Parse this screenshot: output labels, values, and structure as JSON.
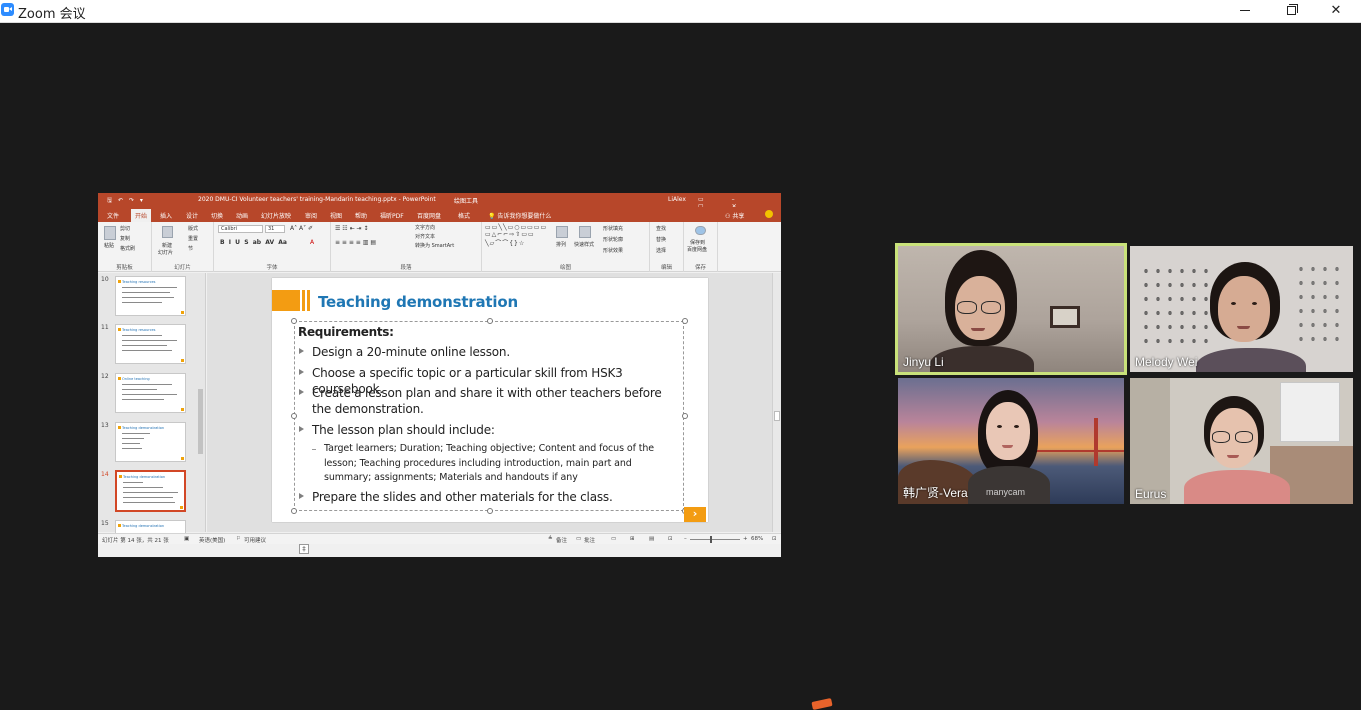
{
  "window": {
    "title": "Zoom 会议",
    "minimize_icon": "minimize-icon",
    "maximize_icon": "restore-icon",
    "close_glyph": "✕"
  },
  "powerpoint": {
    "quick_access": "🖫 ↶ ↷ ▾",
    "document_title": "2020 DMU-CI Volunteer teachers' training-Mandarin teaching.pptx - PowerPoint",
    "context_tools": "绘图工具",
    "user": "LiAlex",
    "window_buttons": "▭ – ▢ ✕",
    "tabs": [
      "文件",
      "开始",
      "插入",
      "设计",
      "切换",
      "动画",
      "幻灯片放映",
      "审阅",
      "视图",
      "帮助",
      "福昕PDF",
      "百度网盘",
      "格式"
    ],
    "active_tab": "开始",
    "tell_me": "告诉我你想要做什么",
    "share": "共享",
    "ribbon": {
      "clipboard": {
        "paste": "粘贴",
        "cut": "剪切",
        "copy": "复制",
        "format_painter": "格式刷",
        "name": "剪贴板"
      },
      "slides": {
        "new_slide": "新建",
        "new_slide2": "幻灯片",
        "layout": "版式",
        "reset": "重置",
        "section": "节",
        "name": "幻灯片"
      },
      "font": {
        "font_name": "Calibri",
        "font_size": "31",
        "name": "字体"
      },
      "paragraph": {
        "text_direction": "文字方向",
        "align_text": "对齐文本",
        "smartart": "转换为 SmartArt",
        "name": "段落"
      },
      "drawing": {
        "arrange": "排列",
        "quick_styles": "快速样式",
        "shape_fill": "形状填充",
        "shape_outline": "形状轮廓",
        "shape_effects": "形状效果",
        "name": "绘图"
      },
      "editing": {
        "find": "查找",
        "replace": "替换",
        "select": "选择",
        "name": "编辑"
      },
      "save": {
        "label1": "保存到",
        "label2": "百度网盘",
        "name": "保存"
      }
    },
    "thumbnails": [
      {
        "num": "10",
        "title": "Teaching resources"
      },
      {
        "num": "11",
        "title": "Teaching resources"
      },
      {
        "num": "12",
        "title": "Online teaching"
      },
      {
        "num": "13",
        "title": "Teaching demonstration"
      },
      {
        "num": "14",
        "title": "Teaching demonstration"
      },
      {
        "num": "15",
        "title": "Teaching demonstration"
      }
    ],
    "active_thumbnail": "14",
    "slide": {
      "title": "Teaching demonstration",
      "requirements": "Requirements:",
      "bullets": [
        "Design a 20-minute online lesson.",
        "Choose a specific topic or a particular skill from HSK3 coursebook.",
        "Create a lesson plan and share it with other teachers before the demonstration.",
        "The lesson plan should include:"
      ],
      "sub_bullet": "Target learners; Duration; Teaching objective; Content and focus of the lesson; Teaching procedures including introduction, main part and summary; assignments; Materials and handouts if any",
      "last_bullet": "Prepare the slides and other materials for the class.",
      "next_glyph": "›",
      "autofit_glyph": "‡"
    },
    "status": {
      "slide_count": "幻灯片 第 14 张，共 21 张",
      "language": "英语(美国)",
      "accessibility": "可用建议",
      "notes": "备注",
      "comments": "批注",
      "zoom": "68%"
    }
  },
  "participants": [
    {
      "name": "Jinyu Li",
      "active_speaker": true
    },
    {
      "name": "Melody Wei",
      "active_speaker": false
    },
    {
      "name": "韩广贤-Vera",
      "active_speaker": false,
      "watermark": "manycam"
    },
    {
      "name": "Eurus",
      "active_speaker": false
    }
  ],
  "colors": {
    "ppt_accent": "#b7472a",
    "slide_title": "#1f77b4",
    "slide_orange": "#f39c12",
    "speaker_highlight": "#c9e27a",
    "zoom_blue": "#2d8cff"
  }
}
